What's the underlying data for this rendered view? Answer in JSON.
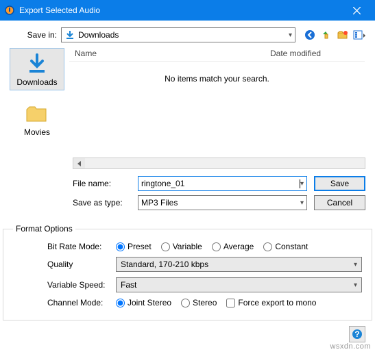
{
  "window": {
    "title": "Export Selected Audio",
    "watermark": "wsxdn.com"
  },
  "saveIn": {
    "label": "Save in:",
    "value": "Downloads"
  },
  "sidebar": {
    "items": [
      {
        "label": "Downloads",
        "selected": true
      },
      {
        "label": "Movies",
        "selected": false
      }
    ]
  },
  "fileList": {
    "columns": {
      "name": "Name",
      "date": "Date modified"
    },
    "emptyMessage": "No items match your search."
  },
  "fileForm": {
    "fileNameLabel": "File name:",
    "fileNameValue": "ringtone_01",
    "saveTypeLabel": "Save as type:",
    "saveTypeValue": "MP3 Files",
    "saveBtn": "Save",
    "cancelBtn": "Cancel"
  },
  "formatOptions": {
    "legend": "Format Options",
    "bitRateMode": {
      "label": "Bit Rate Mode:",
      "options": [
        "Preset",
        "Variable",
        "Average",
        "Constant"
      ],
      "selected": "Preset"
    },
    "quality": {
      "label": "Quality",
      "value": "Standard, 170-210 kbps"
    },
    "variableSpeed": {
      "label": "Variable Speed:",
      "value": "Fast"
    },
    "channelMode": {
      "label": "Channel Mode:",
      "options": [
        "Joint Stereo",
        "Stereo"
      ],
      "selected": "Joint Stereo",
      "forceMono": "Force export to mono"
    }
  }
}
